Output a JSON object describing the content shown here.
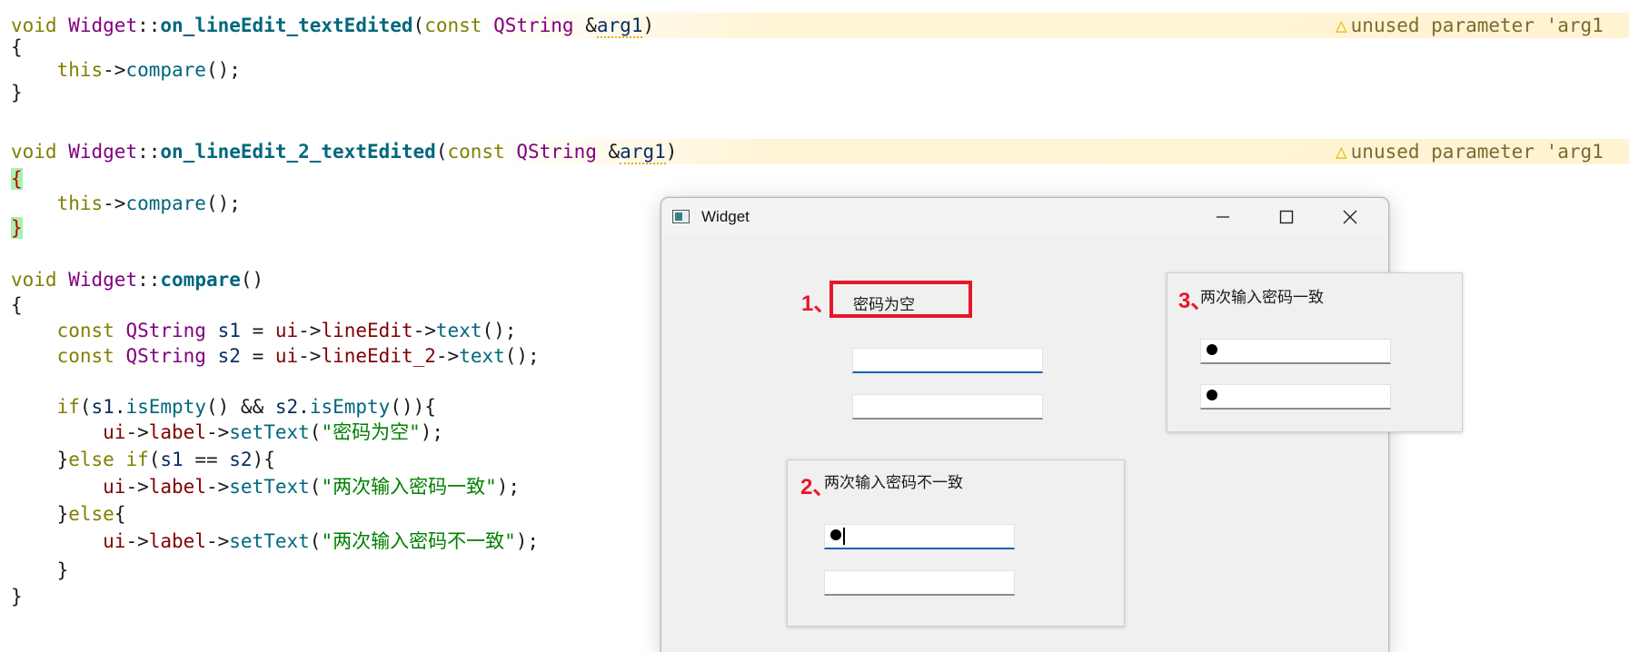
{
  "editor": {
    "warning_text": "unused parameter 'arg1",
    "lines": {
      "l1": {
        "kw1": "void",
        "cls": "Widget",
        "sep": "::",
        "fn": "on_lineEdit_textEdited",
        "open": "(",
        "kw2": "const",
        "ty": "QString",
        "amp": " &",
        "param": "arg1",
        "close": ")"
      },
      "l2": "{",
      "l3": {
        "this": "this",
        "arrow": "->",
        "call": "compare",
        "end": "();"
      },
      "l4": "}",
      "l6": {
        "kw1": "void",
        "cls": "Widget",
        "sep": "::",
        "fn": "on_lineEdit_2_textEdited",
        "open": "(",
        "kw2": "const",
        "ty": "QString",
        "amp": " &",
        "param": "arg1",
        "close": ")"
      },
      "l7": "{",
      "l8": {
        "this": "this",
        "arrow": "->",
        "call": "compare",
        "end": "();"
      },
      "l9": "}",
      "l11": {
        "kw1": "void",
        "cls": "Widget",
        "sep": "::",
        "fn": "compare",
        "end": "()"
      },
      "l12": "{",
      "l13": {
        "kw": "const",
        "ty": "QString",
        "var": "s1",
        "eq": " = ",
        "ui": "ui",
        "a1": "->",
        "m": "lineEdit",
        "a2": "->",
        "call": "text",
        "end": "();"
      },
      "l14": {
        "kw": "const",
        "ty": "QString",
        "var": "s2",
        "eq": " = ",
        "ui": "ui",
        "a1": "->",
        "m": "lineEdit_2",
        "a2": "->",
        "call": "text",
        "end": "();"
      },
      "l16": {
        "if": "if",
        "p1": "(",
        "s1": "s1",
        "d1": ".",
        "e1": "isEmpty",
        "p2": "() && ",
        "s2": "s2",
        "d2": ".",
        "e2": "isEmpty",
        "p3": "()){"
      },
      "l17": {
        "ui": "ui",
        "a1": "->",
        "m": "label",
        "a2": "->",
        "call": "setText",
        "open": "(",
        "str": "\"密码为空\"",
        "end": ");"
      },
      "l18": {
        "pre": "}",
        "kw": "else if",
        "p1": "(",
        "s1": "s1",
        "eq": " == ",
        "s2": "s2",
        "p2": "){"
      },
      "l19": {
        "ui": "ui",
        "a1": "->",
        "m": "label",
        "a2": "->",
        "call": "setText",
        "open": "(",
        "str": "\"两次输入密码一致\"",
        "end": ");"
      },
      "l20": {
        "pre": "}",
        "kw": "else",
        "post": "{"
      },
      "l21": {
        "ui": "ui",
        "a1": "->",
        "m": "label",
        "a2": "->",
        "call": "setText",
        "open": "(",
        "str": "\"两次输入密码不一致\"",
        "end": ");"
      },
      "l22": "}",
      "l23": "}"
    }
  },
  "window": {
    "title": "Widget",
    "state1": {
      "number": "1、",
      "label": "密码为空"
    },
    "state2": {
      "number": "2、",
      "label": "两次输入密码不一致"
    },
    "state3": {
      "number": "3、",
      "label": "两次输入密码一致"
    }
  },
  "colors": {
    "annotation_red": "#e8162b",
    "warning_yellow": "#e8b800",
    "focus_blue": "#1a5fb4"
  }
}
